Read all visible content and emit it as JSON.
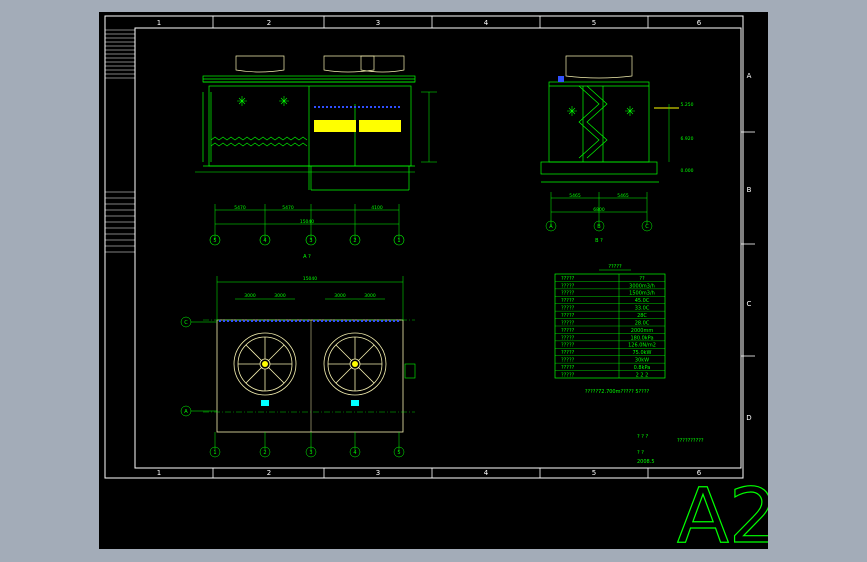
{
  "sheet": {
    "size_label": "A2",
    "column_labels": [
      "1",
      "2",
      "3",
      "4",
      "5",
      "6"
    ],
    "row_labels": [
      "A",
      "B",
      "C",
      "D"
    ]
  },
  "views": {
    "front_view_caption": "A ?",
    "side_view_caption": "B ?",
    "front_dims": {
      "total_width": "15040",
      "bays": [
        "5470",
        "5470",
        "4100"
      ]
    },
    "side_dims": {
      "total_width": "6800",
      "parts": [
        "5465",
        "5465"
      ]
    },
    "side_elevations": [
      "5.250",
      "6.920",
      "0.000"
    ],
    "front_axes": [
      "5",
      "4",
      "3",
      "2",
      "1"
    ],
    "side_axes": [
      "A",
      "B",
      "C"
    ],
    "plan_axes_bottom": [
      "1",
      "2",
      "3",
      "4",
      "5"
    ],
    "plan_axes_left": [
      "C",
      "A"
    ],
    "plan_dims_top": {
      "total": "15040",
      "fan_pair_1": [
        "3000",
        "3000"
      ],
      "fan_pair_2": [
        "3000",
        "3000"
      ]
    }
  },
  "spec_table": {
    "title": "?????",
    "header": [
      "?????",
      "??"
    ],
    "rows": [
      [
        "?????",
        "3000m3/h"
      ],
      [
        "?????",
        "1500m3/h"
      ],
      [
        "?????",
        "45.0C"
      ],
      [
        "?????",
        "33.0C"
      ],
      [
        "?????",
        "28C"
      ],
      [
        "?????",
        "28.0C"
      ],
      [
        "?????",
        "2000mm"
      ],
      [
        "?????",
        "180.0kPa"
      ],
      [
        "?????",
        "126.0N/m2"
      ],
      [
        "?????",
        "75.0kW"
      ],
      [
        "?????",
        "30kW"
      ],
      [
        "?????",
        "0.8kPa"
      ],
      [
        "?????",
        "2  2  2"
      ]
    ],
    "note": "?????72.700m????? 5????"
  },
  "title_block": {
    "label_1": "? ? ?",
    "drawing_name": "??????????",
    "label_2": "? ?",
    "date": "2008.5"
  },
  "colors": {
    "background": "#a3acb8",
    "sheet": "#000000",
    "frame": "#ffffff",
    "geometry": "#00ff00",
    "accent_yellow": "#ffff00",
    "accent_blue": "#3050ff",
    "fan_outline": "#f5f0b0"
  }
}
